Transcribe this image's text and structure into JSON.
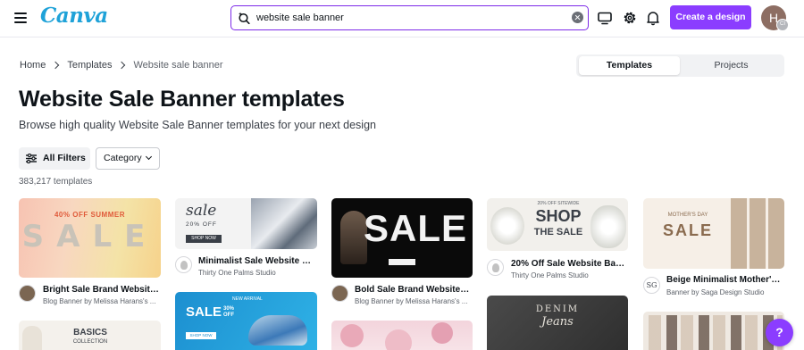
{
  "header": {
    "logo_text": "Canva",
    "search_value": "website sale banner",
    "create_label": "Create a design",
    "avatar_initial": "H",
    "avatar_badge": "CI"
  },
  "breadcrumb": [
    "Home",
    "Templates",
    "Website sale banner"
  ],
  "tabs": [
    "Templates",
    "Projects"
  ],
  "page": {
    "title": "Website Sale Banner templates",
    "subtitle": "Browse high quality Website Sale Banner templates for your next design"
  },
  "filters": {
    "all_filters_label": "All Filters",
    "category_label": "Category"
  },
  "template_count": "383,217 templates",
  "cards": [
    {
      "title": "Bright Sale Brand Website ...",
      "author": "Blog Banner by Melissa Harans's ...",
      "thumb_text": "40% OFF SUMMER",
      "thumb_big": "SALE"
    },
    {
      "title": "Minimalist Sale Website Ba...",
      "author": "Thirty One Palms Studio",
      "thumb_text": "sale",
      "thumb_sub": "20% OFF",
      "thumb_btn": "SHOP NOW"
    },
    {
      "title": "Bold Sale Brand Website H...",
      "author": "Blog Banner by Melissa Harans's ...",
      "thumb_big": "SALE"
    },
    {
      "title": "20% Off Sale Website Bann...",
      "author": "Thirty One Palms Studio",
      "thumb_text": "20% OFF SITEWIDE",
      "thumb_big": "SHOP",
      "thumb_sub": "THE SALE"
    },
    {
      "title": "Beige Minimalist Mother's ...",
      "author": "Banner by Saga Design Studio",
      "thumb_text": "MOTHER'S DAY",
      "thumb_big": "SALE",
      "avatar_text": "SG"
    },
    {
      "thumb_text": "BASICS",
      "thumb_sub": "COLLECTION"
    },
    {
      "thumb_text": "SALE",
      "thumb_sub": "30% OFF",
      "thumb_btn": "SHOP NOW",
      "thumb_top": "NEW ARRIVAL"
    },
    {
      "thumb_text": ""
    },
    {
      "thumb_text": "DENIM",
      "thumb_sub": "Jeans"
    },
    {
      "thumb_text": ""
    }
  ],
  "help_label": "?",
  "colors": {
    "brand": "#8b3dff",
    "canva_logo": "#1fa2d8",
    "search_border": "#7d2ae8"
  }
}
